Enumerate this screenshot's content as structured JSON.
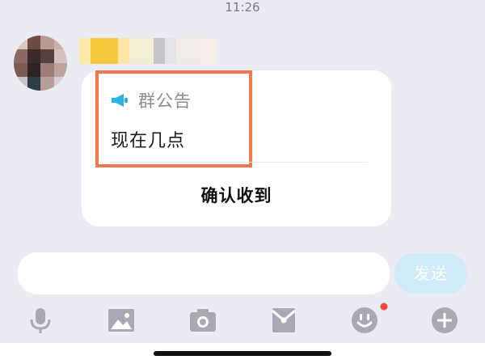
{
  "status_bar": {
    "time": "11:26"
  },
  "sender": {
    "avatar_pixels": [
      "#dac7c0",
      "#6e4a43",
      "#b69a93",
      "#c9b0a8",
      "#8a6a63",
      "#3b2a28",
      "#5b3f3a",
      "#d2c1bd",
      "#7c5b55",
      "#2d2322",
      "#9c7d77",
      "#bda39c",
      "#c9c1c4",
      "#2e3e46",
      "#b89f9a",
      "#d9ced0"
    ],
    "name_pixels": [
      "#fde9a6",
      "#f8c83c",
      "#f6c73f",
      "#fbe6a8",
      "#f3efd3",
      "#c5c4c9",
      "#e4e3e8",
      "#f1ece8",
      "#f7ede9"
    ]
  },
  "announcement": {
    "title": "群公告",
    "content": "现在几点",
    "confirm_label": "确认收到",
    "icon": "megaphone-icon",
    "icon_color": "#28b2e8",
    "highlight_color": "#f0774f"
  },
  "composer": {
    "input_value": "",
    "send_label": "发送"
  },
  "toolbar": {
    "items": [
      "microphone-icon",
      "image-icon",
      "camera-icon",
      "red-packet-icon",
      "emoji-icon",
      "plus-icon"
    ],
    "icon_color": "#a9a9b3",
    "badge_color": "#f14a3c"
  }
}
